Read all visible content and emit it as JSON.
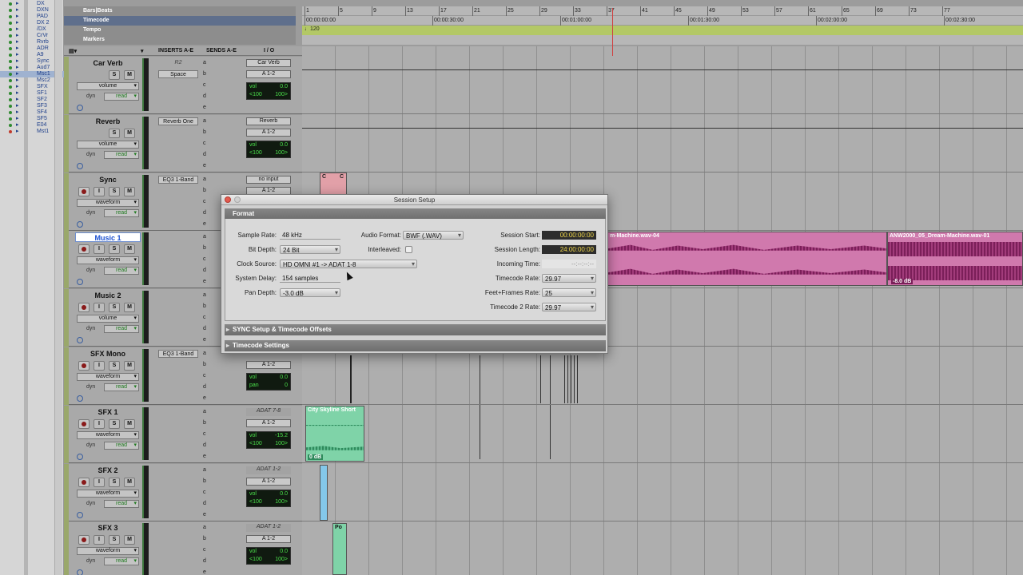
{
  "tracklist": {
    "items": [
      {
        "name": "DX",
        "color": "green"
      },
      {
        "name": "DXN",
        "color": "green"
      },
      {
        "name": "PAD",
        "color": "green"
      },
      {
        "name": "DX 2",
        "color": "green"
      },
      {
        "name": "/DX",
        "color": "green"
      },
      {
        "name": "CrVr",
        "color": "green"
      },
      {
        "name": "Rvrb",
        "color": "green"
      },
      {
        "name": "ADR",
        "color": "green"
      },
      {
        "name": "A9",
        "color": "green"
      },
      {
        "name": "Sync",
        "color": "green"
      },
      {
        "name": "Aud7",
        "color": "green"
      },
      {
        "name": "Msc1",
        "color": "green",
        "selected": true
      },
      {
        "name": "Msc2",
        "color": "green"
      },
      {
        "name": "SFX",
        "color": "green"
      },
      {
        "name": "SF1",
        "color": "green"
      },
      {
        "name": "SF2",
        "color": "green"
      },
      {
        "name": "SF3",
        "color": "green"
      },
      {
        "name": "SF4",
        "color": "green"
      },
      {
        "name": "SF5",
        "color": "green"
      },
      {
        "name": "E04",
        "color": "green"
      },
      {
        "name": "Mst1",
        "color": "red"
      }
    ]
  },
  "rulers": {
    "bars": {
      "label": "Bars|Beats",
      "ticks": [
        "1",
        "5",
        "9",
        "13",
        "17",
        "21",
        "25",
        "29",
        "33",
        "37",
        "41",
        "45",
        "49",
        "53",
        "57",
        "61",
        "65",
        "69",
        "73",
        "77"
      ]
    },
    "timecode": {
      "label": "Timecode",
      "ticks": [
        "00:00:00:00",
        "00:00:30:00",
        "00:01:00:00",
        "00:01:30:00",
        "00:02:00:00",
        "00:02:30:00"
      ]
    },
    "tempo": {
      "label": "Tempo",
      "value": "♩120"
    },
    "markers": {
      "label": "Markers"
    }
  },
  "columns": {
    "inserts": "INSERTS A-E",
    "sends": "SENDS A-E",
    "io": "I / O"
  },
  "tracks": [
    {
      "name": "Car Verb",
      "view": "volume",
      "automation": "read",
      "insert": "R2",
      "insert2": "Space",
      "io_in": "Car Verb",
      "io_out": "A 1-2",
      "vol": "0.0",
      "pan_l": "<100",
      "pan_r": "100>",
      "buttons": false
    },
    {
      "name": "Reverb",
      "view": "volume",
      "automation": "read",
      "insert": "Reverb One",
      "io_in": "Reverb",
      "io_out": "A 1-2",
      "vol": "0.0",
      "pan_l": "<100",
      "pan_r": "100>",
      "buttons": false
    },
    {
      "name": "Sync",
      "view": "waveform",
      "automation": "read",
      "insert": "EQ3 1-Band",
      "io_in": "no input",
      "io_out": "A 1-2",
      "vol": "",
      "pan_l": "",
      "pan_r": "",
      "buttons": true
    },
    {
      "name": "Music 1",
      "view": "waveform",
      "automation": "read",
      "insert": "",
      "io_in": "",
      "io_out": "",
      "vol": "",
      "pan_l": "",
      "pan_r": "",
      "buttons": true,
      "selected": true
    },
    {
      "name": "Music 2",
      "view": "volume",
      "automation": "read",
      "insert": "",
      "io_in": "",
      "io_out": "",
      "vol": "",
      "pan_l": "",
      "pan_r": "",
      "buttons": true
    },
    {
      "name": "SFX Mono",
      "view": "waveform",
      "automation": "read",
      "insert": "EQ3 1-Band",
      "io_in": "",
      "io_out": "A 1-2",
      "vol": "0.0",
      "pan_l": "pan",
      "pan_r": "0",
      "buttons": true
    },
    {
      "name": "SFX 1",
      "view": "waveform",
      "automation": "read",
      "insert": "",
      "io_in": "ADAT 7-8",
      "io_out": "A 1-2",
      "vol": "-15.2",
      "pan_l": "<100",
      "pan_r": "100>",
      "buttons": true
    },
    {
      "name": "SFX 2",
      "view": "waveform",
      "automation": "read",
      "insert": "",
      "io_in": "ADAT 1-2",
      "io_out": "A 1-2",
      "vol": "0.0",
      "pan_l": "<100",
      "pan_r": "100>",
      "buttons": true
    },
    {
      "name": "SFX 3",
      "view": "waveform",
      "automation": "read",
      "insert": "",
      "io_in": "ADAT 1-2",
      "io_out": "A 1-2",
      "vol": "0.0",
      "pan_l": "<100",
      "pan_r": "100>",
      "buttons": true
    }
  ],
  "strip": {
    "send_letters": [
      "a",
      "b",
      "c",
      "d",
      "e"
    ],
    "dyn": "dyn",
    "vol_label": "vol",
    "button_i": "I",
    "button_s": "S",
    "button_m": "M"
  },
  "clips": {
    "music_a": "m-Machine.wav-04",
    "music_b": "ANW2000_05_Dream-Machine.wav-01",
    "music_gain": "-8.0 dB",
    "city": "City Skyline Short",
    "city_gain": "0 dB",
    "sfx3_clip": "Po",
    "sync_a": "C",
    "sync_b": "C"
  },
  "dialog": {
    "title": "Session Setup",
    "format_header": "Format",
    "sync_header": "SYNC Setup & Timecode Offsets",
    "timecode_header": "Timecode Settings",
    "labels": {
      "sample_rate": "Sample Rate:",
      "bit_depth": "Bit Depth:",
      "clock_source": "Clock Source:",
      "system_delay": "System Delay:",
      "pan_depth": "Pan Depth:",
      "audio_format": "Audio Format:",
      "interleaved": "Interleaved:",
      "session_start": "Session Start:",
      "session_length": "Session Length:",
      "incoming_time": "Incoming Time:",
      "timecode_rate": "Timecode Rate:",
      "feet_frames_rate": "Feet+Frames Rate:",
      "timecode2_rate": "Timecode 2 Rate:"
    },
    "values": {
      "sample_rate": "48 kHz",
      "bit_depth": "24 Bit",
      "clock_source": "HD OMNI #1 -> ADAT 1-8",
      "system_delay": "154 samples",
      "pan_depth": "-3.0 dB",
      "audio_format": "BWF (.WAV)",
      "interleaved": false,
      "session_start": "00:00:00:00",
      "session_length": "24:00:00:00",
      "incoming_time": "--:--:--:--",
      "timecode_rate": "29.97",
      "feet_frames_rate": "25",
      "timecode2_rate": "29.97"
    }
  },
  "colors": {
    "timecode_ruler": "#5f6f8c",
    "tempo_lane": "#b3c866",
    "music_clip": "#c7579b",
    "sfx_clip": "#7fd3a8",
    "sync_clip": "#e2a0a8",
    "tc_display": "#f1d84a",
    "close_button": "#e35a4e"
  }
}
